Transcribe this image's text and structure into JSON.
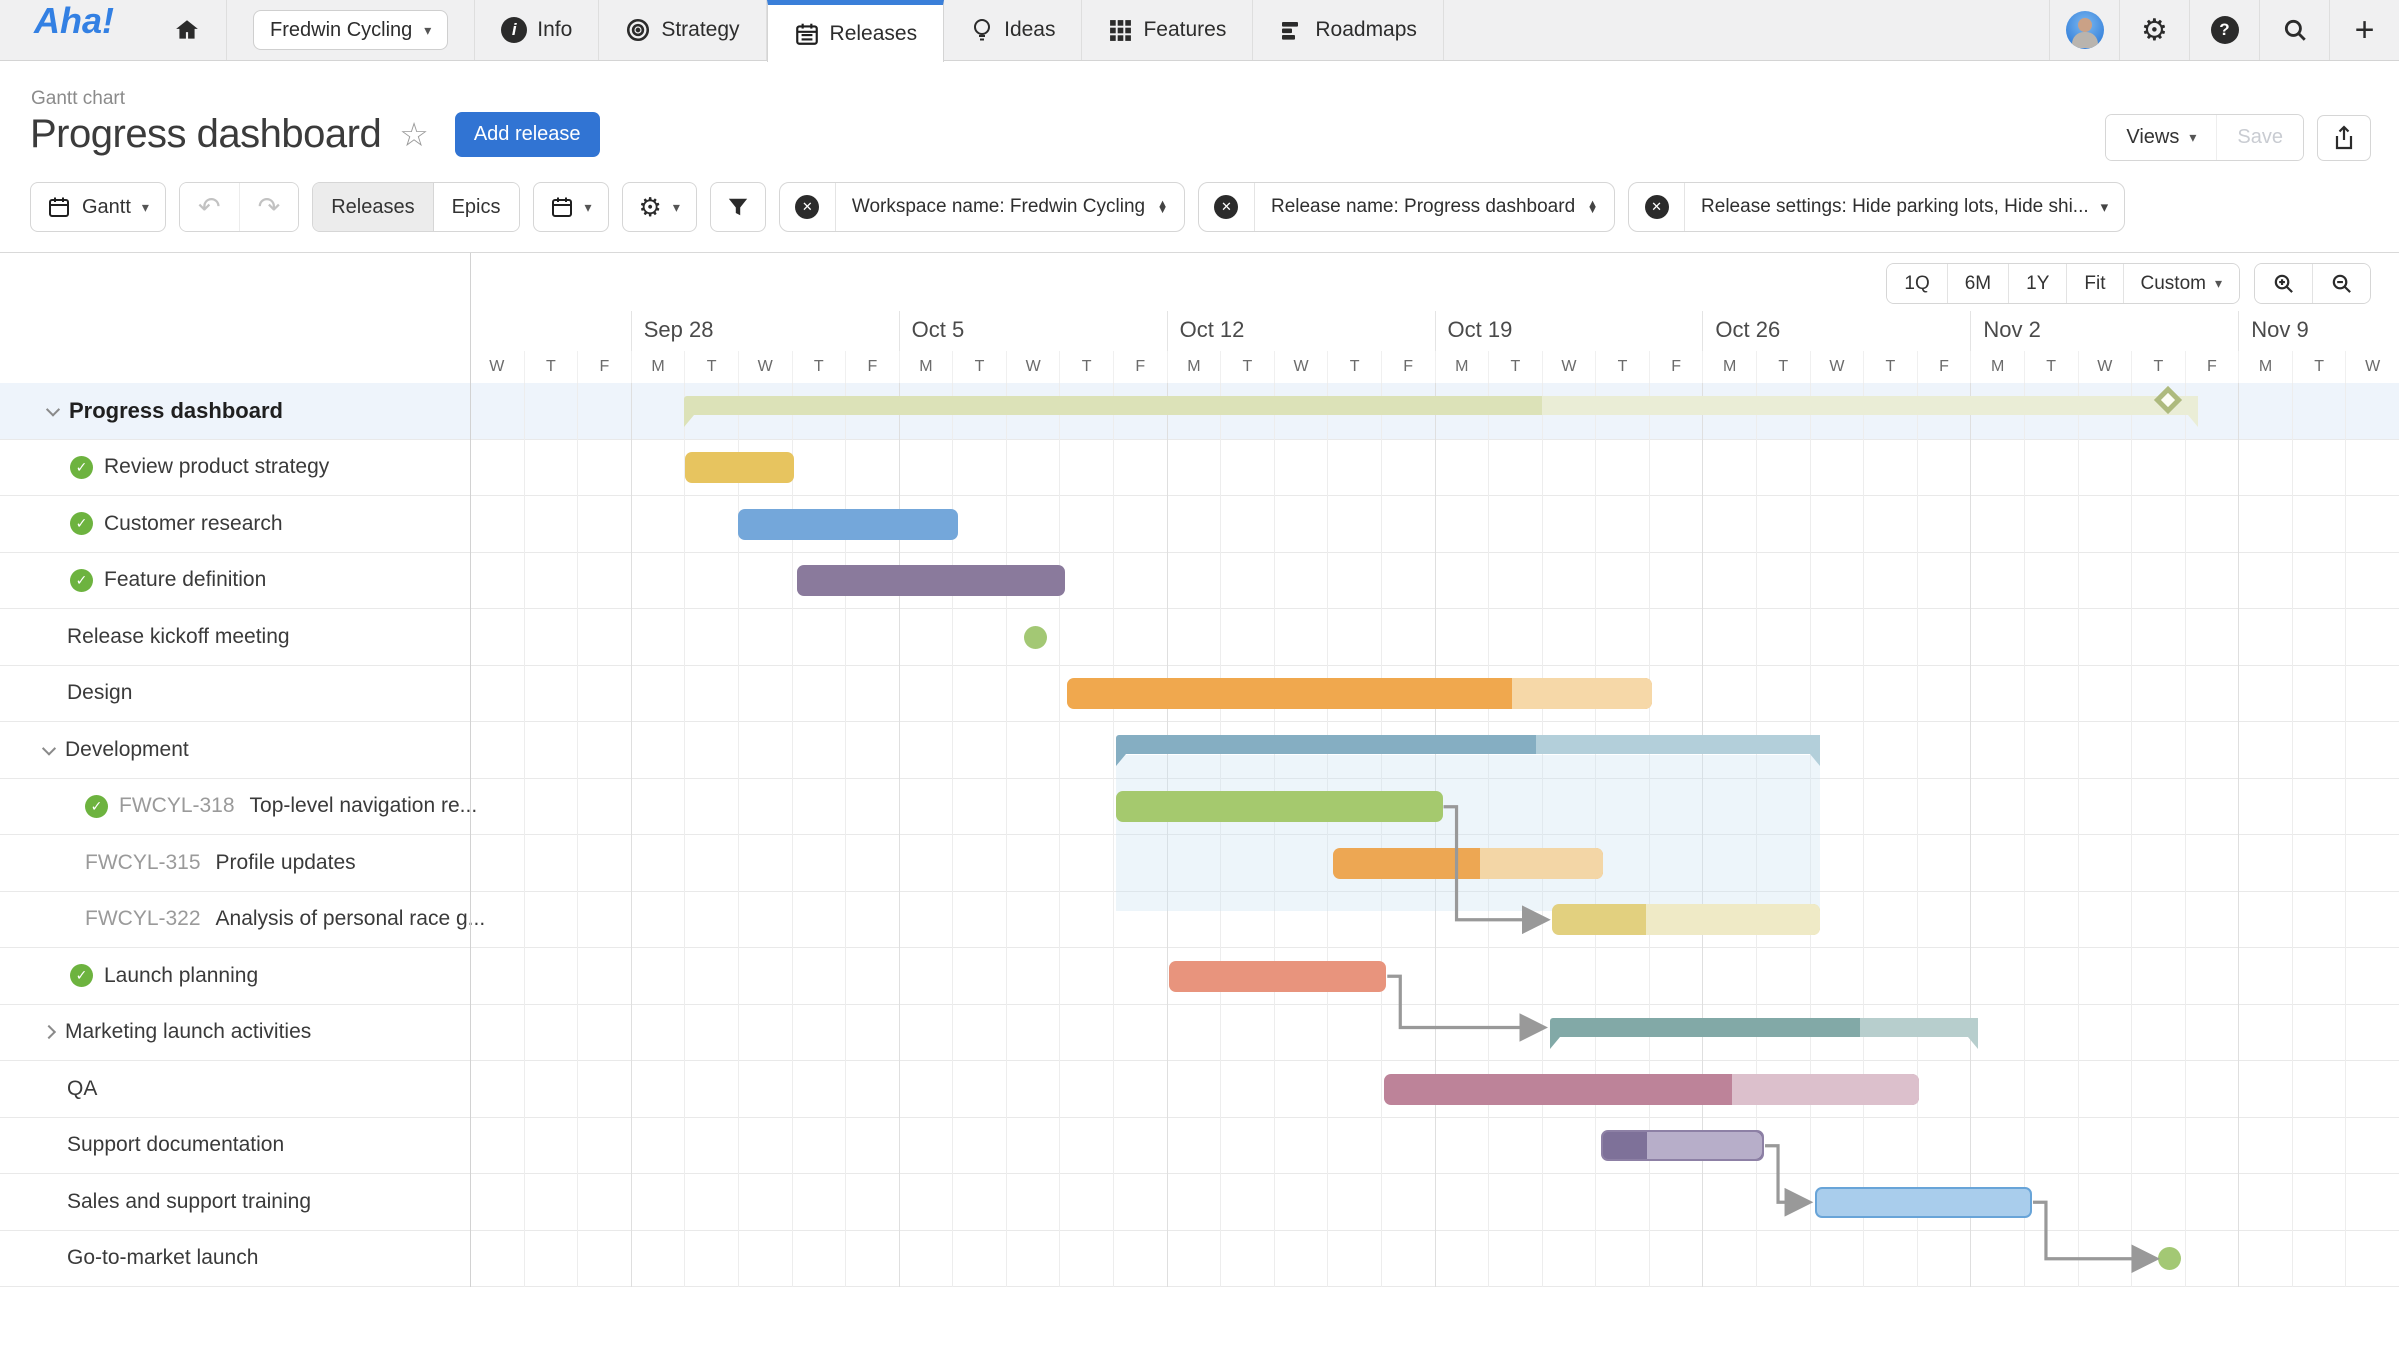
{
  "nav": {
    "logo": "Aha!",
    "workspace": {
      "label": "Fredwin Cycling"
    },
    "items": [
      {
        "label": "Info",
        "icon": "info-icon"
      },
      {
        "label": "Strategy",
        "icon": "target-icon"
      },
      {
        "label": "Releases",
        "icon": "calendar-icon",
        "active": true
      },
      {
        "label": "Ideas",
        "icon": "lightbulb-icon"
      },
      {
        "label": "Features",
        "icon": "grid-icon"
      },
      {
        "label": "Roadmaps",
        "icon": "roadmap-icon"
      }
    ]
  },
  "header": {
    "breadcrumb": "Gantt chart",
    "title": "Progress dashboard",
    "add_release": "Add release",
    "views": "Views",
    "save": "Save"
  },
  "toolbar": {
    "view_type": "Gantt",
    "segments": {
      "releases": "Releases",
      "epics": "Epics"
    },
    "filters": [
      "Workspace name: Fredwin Cycling",
      "Release name: Progress dashboard",
      "Release settings: Hide parking lots, Hide shi..."
    ]
  },
  "zoom_bar": {
    "presets": [
      "1Q",
      "6M",
      "1Y",
      "Fit"
    ],
    "custom": "Custom"
  },
  "colors": {
    "accent_blue": "#3174d3",
    "tab_blue": "#3a7fd9",
    "check_green": "#6db33f",
    "arrow_gray": "#999999"
  },
  "chart_data": {
    "type": "gantt",
    "timeline": {
      "lead_days": [
        "W",
        "T",
        "F"
      ],
      "week_labels": [
        "Sep 28",
        "Oct 5",
        "Oct 12",
        "Oct 19",
        "Oct 26",
        "Nov 2",
        "Nov 9"
      ],
      "week_day_pattern": [
        "M",
        "T",
        "W",
        "T",
        "F"
      ],
      "trail_days": [
        "M",
        "T",
        "W"
      ]
    },
    "rows": [
      {
        "label": "Progress dashboard",
        "kind": "release",
        "chevron": "down",
        "bar": {
          "type": "summary",
          "start": 4.0,
          "end": 32.25,
          "split": 20.0,
          "color": "#dce2b8",
          "light": "#eaedd6",
          "diamond": 31.78
        }
      },
      {
        "label": "Review product strategy",
        "check": true,
        "bar": {
          "type": "task",
          "start": 4.02,
          "end": 6.05,
          "color": "#e7c45f"
        }
      },
      {
        "label": "Customer research",
        "check": true,
        "bar": {
          "type": "task",
          "start": 5.0,
          "end": 9.1,
          "color": "#74a7da"
        }
      },
      {
        "label": "Feature definition",
        "check": true,
        "bar": {
          "type": "task",
          "start": 6.1,
          "end": 11.1,
          "color": "#8a7a9c"
        }
      },
      {
        "label": "Release kickoff meeting",
        "bar": {
          "type": "milestone",
          "at": 10.55,
          "color": "#a3c874"
        }
      },
      {
        "label": "Design",
        "bar": {
          "type": "task",
          "start": 11.15,
          "end": 22.05,
          "split": 19.45,
          "color": "#f0a84e",
          "light": "#f6d8a8"
        }
      },
      {
        "label": "Development",
        "kind": "phase",
        "chevron": "down",
        "bar": {
          "type": "summary",
          "start": 12.05,
          "end": 25.2,
          "split": 19.9,
          "color": "#85aec2",
          "light": "#b3cfda",
          "highlight": true
        }
      },
      {
        "code": "FWCYL-318",
        "label": "Top-level navigation re...",
        "check": true,
        "indent2": true,
        "bar": {
          "type": "task",
          "start": 12.05,
          "end": 18.15,
          "color": "#a5c96e"
        }
      },
      {
        "code": "FWCYL-315",
        "label": "Profile updates",
        "indent2": true,
        "bar": {
          "type": "task",
          "start": 16.1,
          "end": 21.15,
          "split": 18.85,
          "color": "#eda753",
          "light": "#f3d6a6"
        }
      },
      {
        "code": "FWCYL-322",
        "label": "Analysis of personal race g...",
        "indent2": true,
        "bar": {
          "type": "task",
          "start": 20.2,
          "end": 25.2,
          "split": 21.95,
          "color": "#e2d07f",
          "light": "#efeac6"
        }
      },
      {
        "label": "Launch planning",
        "check": true,
        "bar": {
          "type": "task",
          "start": 13.05,
          "end": 17.1,
          "color": "#e8947d"
        }
      },
      {
        "label": "Marketing launch activities",
        "kind": "phase",
        "chevron": "right",
        "bar": {
          "type": "summary",
          "start": 20.15,
          "end": 28.15,
          "split": 25.95,
          "color": "#82a9a7",
          "light": "#b7cecd"
        }
      },
      {
        "label": "QA",
        "bar": {
          "type": "task",
          "start": 17.05,
          "end": 27.05,
          "split": 23.55,
          "color": "#bd8399",
          "light": "#dcc0cc"
        }
      },
      {
        "label": "Support documentation",
        "bar": {
          "type": "task",
          "start": 21.1,
          "end": 24.15,
          "split": 21.95,
          "color": "#7e7199",
          "light": "#b7aec9",
          "border": "#8d80a5"
        }
      },
      {
        "label": "Sales and support training",
        "bar": {
          "type": "task",
          "start": 25.1,
          "end": 29.15,
          "color": "#a9cdec",
          "border": "#68a4d8"
        }
      },
      {
        "label": "Go-to-market launch",
        "bar": {
          "type": "milestone",
          "at": 31.72,
          "color": "#a3c874"
        }
      }
    ],
    "dependencies": [
      {
        "from": 7,
        "to": 9
      },
      {
        "from": 10,
        "to": 11
      },
      {
        "from": 13,
        "to": 14
      },
      {
        "from": 14,
        "to": 15
      }
    ]
  }
}
